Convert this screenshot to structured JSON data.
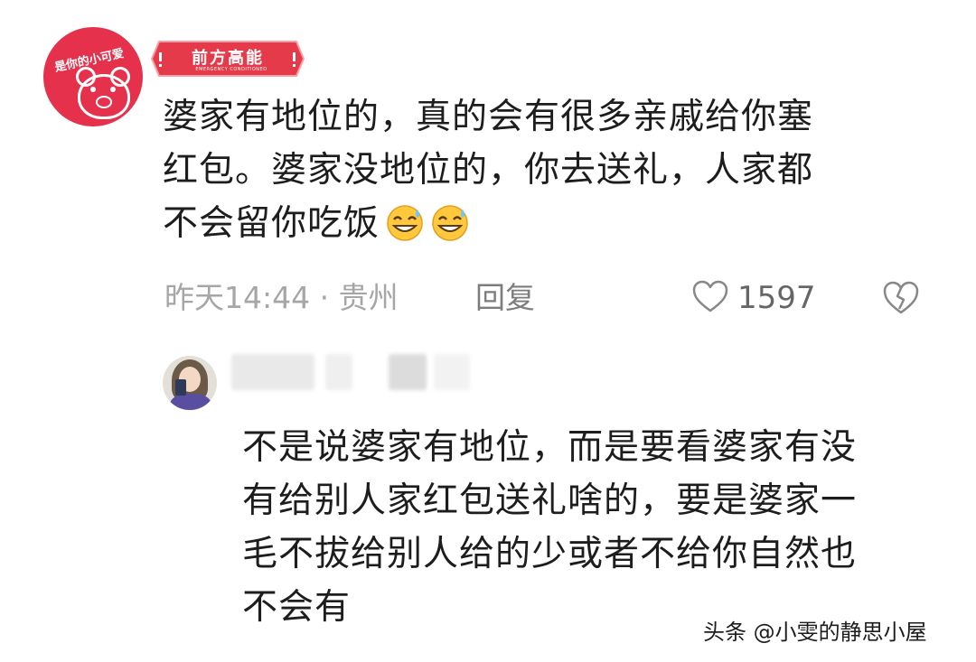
{
  "comment": {
    "avatar_text": "是你的小可爱",
    "badge_label": "前方高能",
    "badge_sub": "EMERGENCY CONDITIONED",
    "text_lines": [
      "婆家有地位的，真的会有很多亲戚给你塞",
      "红包。婆家没地位的，你去送礼，人家都",
      "不会留你吃饭"
    ],
    "emoji": "sweat-smile-icon",
    "time_location": "昨天14:44 · 贵州",
    "reply_label": "回复",
    "like_count": "1597"
  },
  "reply": {
    "text_lines": [
      "不是说婆家有地位，而是要看婆家有没",
      "有给别人家红包送礼啥的，要是婆家一",
      "毛不拔给别人给的少或者不给你自然也",
      "不会有"
    ]
  },
  "watermark": "头条 @小雯的静思小屋",
  "colors": {
    "badge_red": "#e53a4a",
    "avatar_red": "#e6314c",
    "meta_gray": "#a6a6a6",
    "text": "#1d1d1d"
  }
}
